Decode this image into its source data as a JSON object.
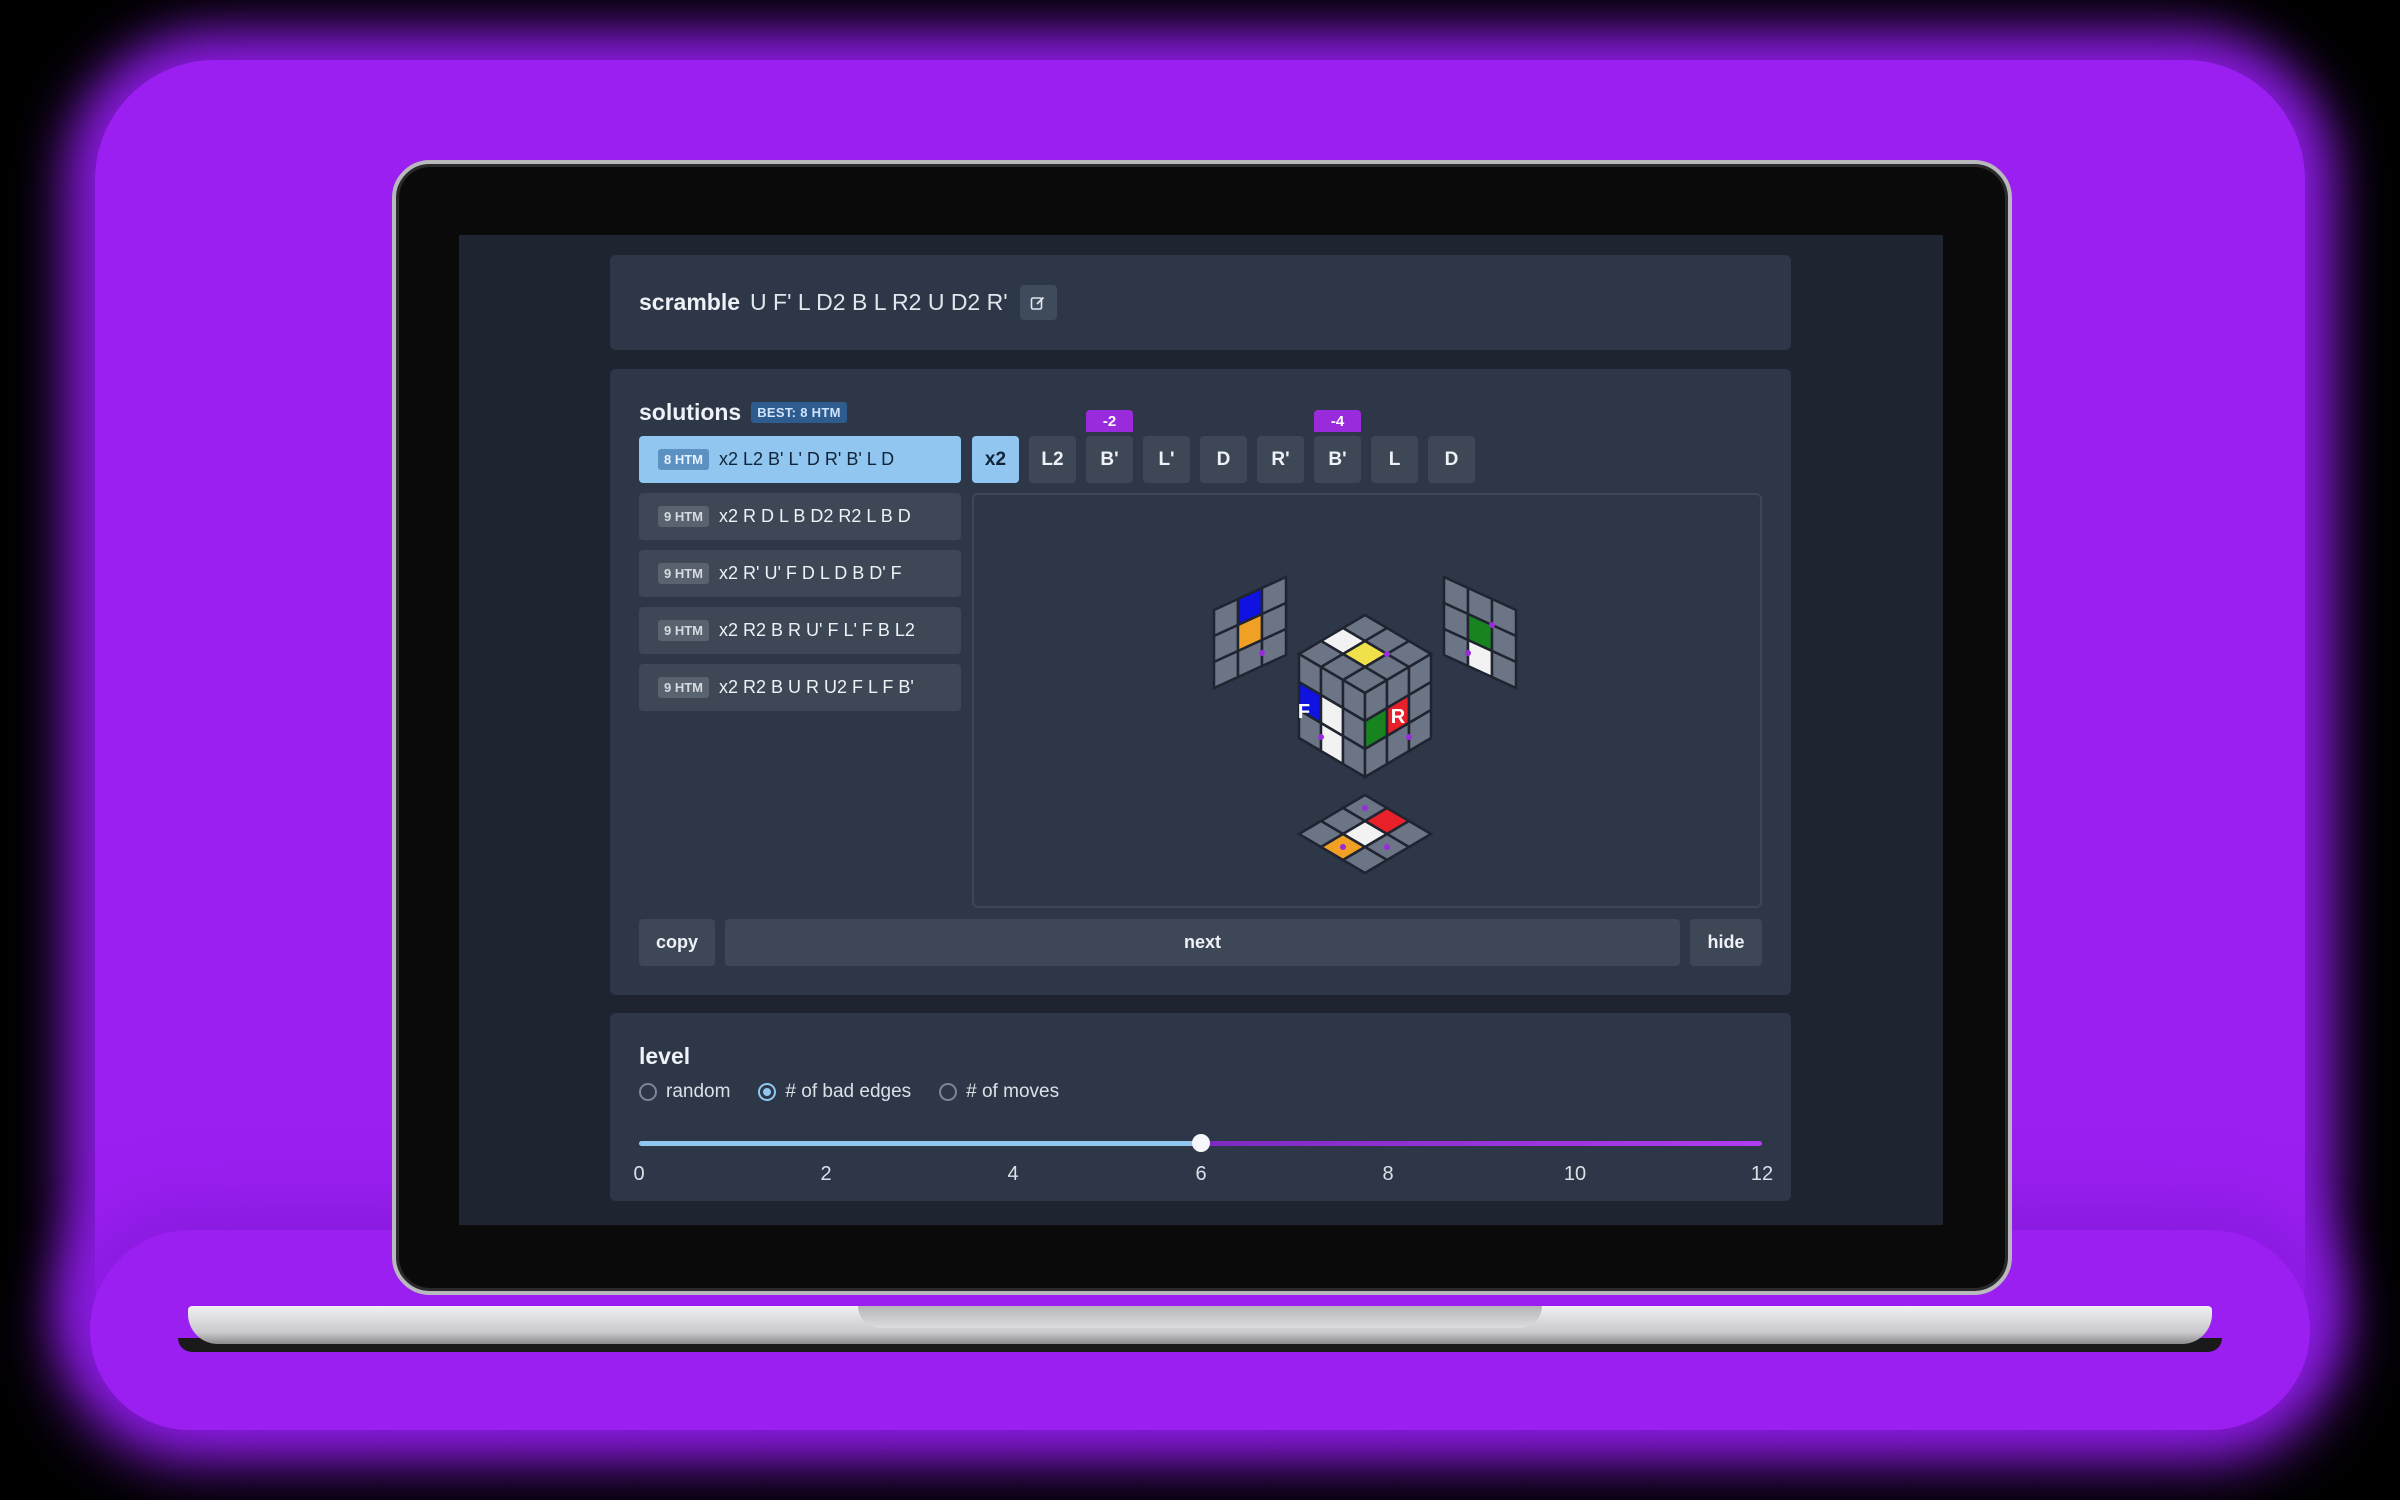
{
  "scramble": {
    "label": "scramble",
    "moves": "U F' L D2 B L R2 U D2 R'"
  },
  "solutions": {
    "label": "solutions",
    "best_badge": "BEST: 8 HTM",
    "items": [
      {
        "htm": "8 HTM",
        "moves": "x2 L2 B' L' D R' B' L D",
        "active": true
      },
      {
        "htm": "9 HTM",
        "moves": "x2 R D L B D2 R2 L B D",
        "active": false
      },
      {
        "htm": "9 HTM",
        "moves": "x2 R' U' F D L D B D' F",
        "active": false
      },
      {
        "htm": "9 HTM",
        "moves": "x2 R2 B R U' F L' F B L2",
        "active": false
      },
      {
        "htm": "9 HTM",
        "moves": "x2 R2 B U R U2 F L F B'",
        "active": false
      }
    ],
    "move_steps": [
      {
        "label": "x2",
        "badge": "",
        "active": true
      },
      {
        "label": "L2",
        "badge": "",
        "active": false
      },
      {
        "label": "B'",
        "badge": "-2",
        "active": false
      },
      {
        "label": "L'",
        "badge": "",
        "active": false
      },
      {
        "label": "D",
        "badge": "",
        "active": false
      },
      {
        "label": "R'",
        "badge": "",
        "active": false
      },
      {
        "label": "B'",
        "badge": "-4",
        "active": false
      },
      {
        "label": "L",
        "badge": "",
        "active": false
      },
      {
        "label": "D",
        "badge": "",
        "active": false
      }
    ],
    "cube_face_labels": {
      "front": "F",
      "right": "R"
    },
    "actions": {
      "copy": "copy",
      "next": "next",
      "hide": "hide"
    }
  },
  "level": {
    "label": "level",
    "options": [
      {
        "label": "random",
        "selected": false
      },
      {
        "label": "# of bad edges",
        "selected": true
      },
      {
        "label": "# of moves",
        "selected": false
      }
    ],
    "slider": {
      "min": 0,
      "max": 12,
      "value": 6
    },
    "ticks": [
      "0",
      "2",
      "4",
      "6",
      "8",
      "10",
      "12"
    ]
  },
  "colors": {
    "accent": "#90c6ef",
    "purple": "#9a2bdc",
    "card": "#2d3747",
    "screen_bg": "#1e2531"
  }
}
